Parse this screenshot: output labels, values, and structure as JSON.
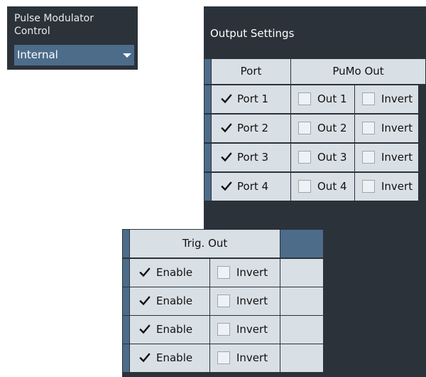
{
  "pulse_modulator": {
    "title_line1": "Pulse Modulator",
    "title_line2": "Control",
    "selected": "Internal"
  },
  "output_settings": {
    "title": "Output Settings",
    "headers": {
      "port": "Port",
      "pumo": "PuMo Out"
    },
    "rows": [
      {
        "port_label": "Port 1",
        "port_checked": true,
        "out_label": "Out 1",
        "out_checked": false,
        "invert_label": "Invert",
        "invert_checked": false
      },
      {
        "port_label": "Port 2",
        "port_checked": true,
        "out_label": "Out 2",
        "out_checked": false,
        "invert_label": "Invert",
        "invert_checked": false
      },
      {
        "port_label": "Port 3",
        "port_checked": true,
        "out_label": "Out 3",
        "out_checked": false,
        "invert_label": "Invert",
        "invert_checked": false
      },
      {
        "port_label": "Port 4",
        "port_checked": true,
        "out_label": "Out 4",
        "out_checked": false,
        "invert_label": "Invert",
        "invert_checked": false
      }
    ]
  },
  "trig_out": {
    "header": "Trig. Out",
    "rows": [
      {
        "enable_label": "Enable",
        "enable_checked": true,
        "invert_label": "Invert",
        "invert_checked": false
      },
      {
        "enable_label": "Enable",
        "enable_checked": true,
        "invert_label": "Invert",
        "invert_checked": false
      },
      {
        "enable_label": "Enable",
        "enable_checked": true,
        "invert_label": "Invert",
        "invert_checked": false
      },
      {
        "enable_label": "Enable",
        "enable_checked": true,
        "invert_label": "Invert",
        "invert_checked": false
      }
    ]
  },
  "colors": {
    "panel": "#2b323a",
    "cell": "#d9e0e5",
    "accent": "#4d6c8a"
  }
}
